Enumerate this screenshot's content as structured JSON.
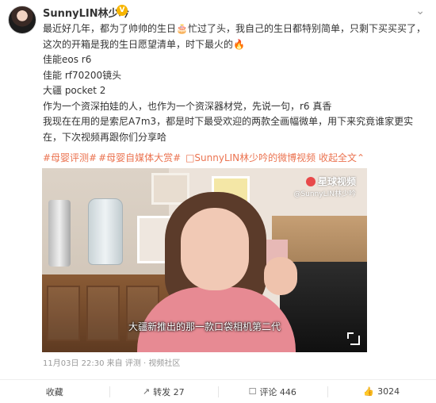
{
  "post": {
    "username": "SunnyLIN林少吟",
    "vip_badge": "V",
    "more_icon": "chevron-down-icon",
    "lines": [
      "最近好几年，都为了帅帅的生日🎂忙过了头，我自己的生日都特别简单，只剩下买买买了，这次的开箱是我的生日愿望清单，时下最火的🔥",
      "佳能eos r6",
      "佳能 rf70200镜头",
      "大疆 pocket 2",
      "作为一个资深拍娃的人，也作为一个资深器材党，先说一句，r6 真香",
      "我现在在用的是索尼A7m3，都是时下最受欢迎的两款全画幅微单，用下来究竟谁家更实在，下次视频再跟你们分享哈"
    ],
    "hashtags": [
      "#母婴评测#",
      "#母婴自媒体大赏#"
    ],
    "video_link": "□SunnyLIN林少吟的微博视频",
    "collapse_label": "收起全文",
    "collapse_icon": "chevron-up-icon"
  },
  "video": {
    "brand": "星球视频",
    "watermark": "@SunnyLIN林少吟",
    "subtitle": "大疆新推出的那一款口袋相机第二代"
  },
  "meta": {
    "date": "11月03日 22:30",
    "source": "来自 评测 · 视频社区"
  },
  "actions": [
    {
      "icon": "star-icon",
      "label": "收藏"
    },
    {
      "icon": "share-icon",
      "label": "转发 27"
    },
    {
      "icon": "comment-icon",
      "label": "评论 446"
    },
    {
      "icon": "thumbs-up-icon",
      "label": "3024"
    }
  ],
  "colors": {
    "link": "#eb7350",
    "vip": "#f7b500"
  }
}
